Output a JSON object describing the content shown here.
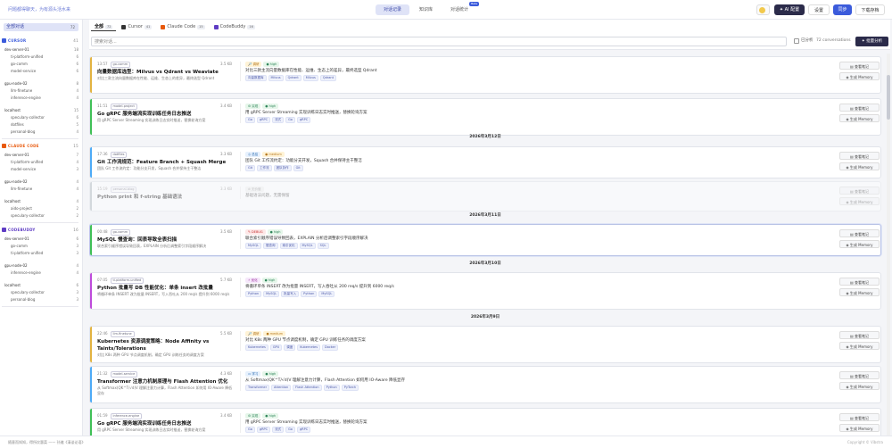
{
  "app": {
    "tagline": "问题都得聊天，为有源头活水来",
    "nav": [
      {
        "label": "对话记录",
        "active": true
      },
      {
        "label": "知识库",
        "active": false
      },
      {
        "label": "对话统计",
        "active": false,
        "badge": "Beta"
      }
    ],
    "buttons": {
      "ai": "✦ AI 配置",
      "settings": "设置",
      "sync": "同步",
      "download": "下载存档"
    }
  },
  "sidebar": {
    "all": {
      "label": "全部对话",
      "count": "72"
    },
    "groups": [
      {
        "name": "CURSOR",
        "count": "41",
        "color": "#3b5bdb",
        "hosts": [
          {
            "host": "dev-server-01",
            "count": "18",
            "items": [
              {
                "label": "ti-platform-unified",
                "count": "6"
              },
              {
                "label": "go-comm",
                "count": "6"
              },
              {
                "label": "model-service",
                "count": "6"
              }
            ]
          },
          {
            "host": "gpu-node-02",
            "count": "8",
            "items": [
              {
                "label": "llm-finetune",
                "count": "4"
              },
              {
                "label": "inference-engine",
                "count": "4"
              }
            ]
          },
          {
            "host": "localhost",
            "count": "15",
            "items": [
              {
                "label": "speculary-collector",
                "count": "6"
              },
              {
                "label": "dotfiles",
                "count": "5"
              },
              {
                "label": "personal-blog",
                "count": "4"
              }
            ]
          }
        ]
      },
      {
        "name": "CLAUDE CODE",
        "count": "15",
        "color": "#e8590c",
        "hosts": [
          {
            "host": "dev-server-01",
            "count": "7",
            "items": [
              {
                "label": "ti-platform-unified",
                "count": "4"
              },
              {
                "label": "model-service",
                "count": "3"
              }
            ]
          },
          {
            "host": "gpu-node-02",
            "count": "4",
            "items": [
              {
                "label": "llm-finetune",
                "count": "4"
              }
            ]
          },
          {
            "host": "localhost",
            "count": "4",
            "items": [
              {
                "label": "aido-project",
                "count": "2"
              },
              {
                "label": "speculary-collector",
                "count": "2"
              }
            ]
          }
        ]
      },
      {
        "name": "CODEBUDDY",
        "count": "16",
        "color": "#5f3dc4",
        "hosts": [
          {
            "host": "dev-server-01",
            "count": "6",
            "items": [
              {
                "label": "go-comm",
                "count": "3"
              },
              {
                "label": "ti-platform-unified",
                "count": "3"
              }
            ]
          },
          {
            "host": "gpu-node-02",
            "count": "4",
            "items": [
              {
                "label": "inference-engine",
                "count": "4"
              }
            ]
          },
          {
            "host": "localhost",
            "count": "6",
            "items": [
              {
                "label": "speculary-collector",
                "count": "3"
              },
              {
                "label": "personal-blog",
                "count": "3"
              }
            ]
          }
        ]
      }
    ]
  },
  "filters": {
    "tabs": [
      {
        "label": "全部",
        "count": "72",
        "active": true,
        "icon": ""
      },
      {
        "label": "Cursor",
        "count": "41",
        "active": false,
        "icon": "#333"
      },
      {
        "label": "Claude Code",
        "count": "15",
        "active": false,
        "icon": "#e8590c"
      },
      {
        "label": "CodeBuddy",
        "count": "16",
        "active": false,
        "icon": "#5f3dc4"
      }
    ],
    "search_placeholder": "搜索对话...",
    "checkbox_label": "已分析",
    "count_label": "72 conversations",
    "bulk": "✦ 批量分析"
  },
  "card_buttons": {
    "view": "查看笔记",
    "memory": "生成 Memory"
  },
  "dates": [
    "2026年3月12日",
    "2026年3月11日",
    "2026年3月10日",
    "2026年3月9日"
  ],
  "cards": [
    {
      "time": "13:57",
      "tag": "go-comm",
      "size": "3.5 KB",
      "title": "向量数据库选型：Milvus vs Qdrant vs Weaviate",
      "desc": "对比三款主流向量数据库在性能、运维、生态上的差异，最终选型 Qdrant",
      "type": "调研",
      "level": "high",
      "summary": "对比三款主流向量数据库在性能、运维、生态上的差异，最终选型 Qdrant",
      "chips": [
        "向量数据库",
        "Milvus",
        "Qdrant",
        "Milvus",
        "Qdrant"
      ],
      "bar": "#e3b341"
    },
    {
      "time": "11:51",
      "tag": "model-project",
      "size": "3.4 KB",
      "title": "Go gRPC 服务端流实现训练任务日志推送",
      "desc": "用 gRPC Server Streaming 实现训练日志实时推送，替换轮询方案",
      "type": "实现",
      "level": "high",
      "summary": "用 gRPC Server Streaming 实现训练日志实时推送，替换轮询方案",
      "chips": [
        "Go",
        "gRPC",
        "流式",
        "Go",
        "gRPC"
      ],
      "bar": "#40c057"
    },
    {
      "time": "17:36",
      "tag": "dotfiles",
      "size": "3.3 KB",
      "title": "Git 工作流规范：Feature Branch + Squash Merge",
      "desc": "团队 Git 工作流约定：功能分支开发，Squash 合并保持主干整洁",
      "type": "总结",
      "level": "medium",
      "summary": "团队 Git 工作流约定：功能分支开发，Squash 合并保持主干整洁",
      "chips": [
        "Git",
        "工作流",
        "团队协作",
        "Git"
      ],
      "bar": "#4dabf7"
    },
    {
      "time": "15:19",
      "tag": "personal-blog",
      "size": "3.3 KB",
      "title": "Python print 和 f-string 基础语法",
      "desc": "",
      "type": "无价值",
      "level": "",
      "summary": "基础语法问题，无需保留",
      "chips": [],
      "bar": "#adb5bd"
    },
    {
      "time": "00:48",
      "tag": "go-comm",
      "size": "3.5 KB",
      "title": "MySQL 慢查询：回表导致全表扫描",
      "desc": "联合索引顺序错误导致回表，EXPLAIN 分析后调整索引字段顺序解决",
      "type": "DEBUG",
      "level": "high",
      "summary": "联合索引顺序错误导致回表，EXPLAIN 分析后调整索引字段顺序解决",
      "chips": [
        "MySQL",
        "慢查询",
        "索引优化",
        "MySQL",
        "SQL"
      ],
      "bar": "#40c057"
    },
    {
      "time": "07:05",
      "tag": "ti-platform-unified",
      "size": "5.7 KB",
      "title": "Python 批量写 DB 性能优化：单条 insert 改批量",
      "desc": "将循环单条 INSERT 改为批量 INSERT，写入吞吐从 200 req/s 提升到 6000 req/s",
      "type": "优化",
      "level": "high",
      "summary": "将循环单条 INSERT 改为批量 INSERT，写入吞吐从 200 req/s 提升到 6000 req/s",
      "chips": [
        "Python",
        "MySQL",
        "批量写入",
        "Python",
        "MySQL"
      ],
      "bar": "#be4bdb"
    },
    {
      "time": "22:46",
      "tag": "llm-finetune",
      "size": "5.5 KB",
      "title": "Kubernetes 资源调度策略：Node Affinity vs Taints/Tolerations",
      "desc": "对比 K8s 两种 GPU 节点调度机制，确定 GPU 训练任务的调度方案",
      "type": "调研",
      "level": "medium",
      "summary": "对比 K8s 两种 GPU 节点调度机制，确定 GPU 训练任务的调度方案",
      "chips": [
        "Kubernetes",
        "GPU",
        "调度",
        "Kubernetes",
        "Docker"
      ],
      "bar": "#e3b341"
    },
    {
      "time": "21:32",
      "tag": "model-service",
      "size": "4.3 KB",
      "title": "Transformer 注意力机制原理与 Flash Attention 优化",
      "desc": "从 Softmax(QK^T/√d)V 理解注意力计算，Flash Attention 如何用 IO-Aware 降低显存",
      "type": "学习",
      "level": "high",
      "summary": "从 Softmax(QK^T/√d)V 理解注意力计算，Flash Attention 如何用 IO-Aware 降低显存",
      "chips": [
        "Transformer",
        "Attention",
        "Flash Attention",
        "Python",
        "PyTorch"
      ],
      "bar": "#4dabf7"
    },
    {
      "time": "01:59",
      "tag": "inference-engine",
      "size": "3.4 KB",
      "title": "Go gRPC 服务端流实现训练任务日志推送",
      "desc": "用 gRPC Server Streaming 实现训练日志实时推送，替换轮询方案",
      "type": "实现",
      "level": "high",
      "summary": "用 gRPC Server Streaming 实现训练日志实时推送，替换轮询方案",
      "chips": [
        "Go",
        "gRPC",
        "流式",
        "Go",
        "gRPC"
      ],
      "bar": "#40c057"
    }
  ],
  "footer": {
    "left": "随意而知知，得所坎惠菜 —— 孙邈《清谈论语》",
    "right": "Copyright © Vibstra"
  }
}
